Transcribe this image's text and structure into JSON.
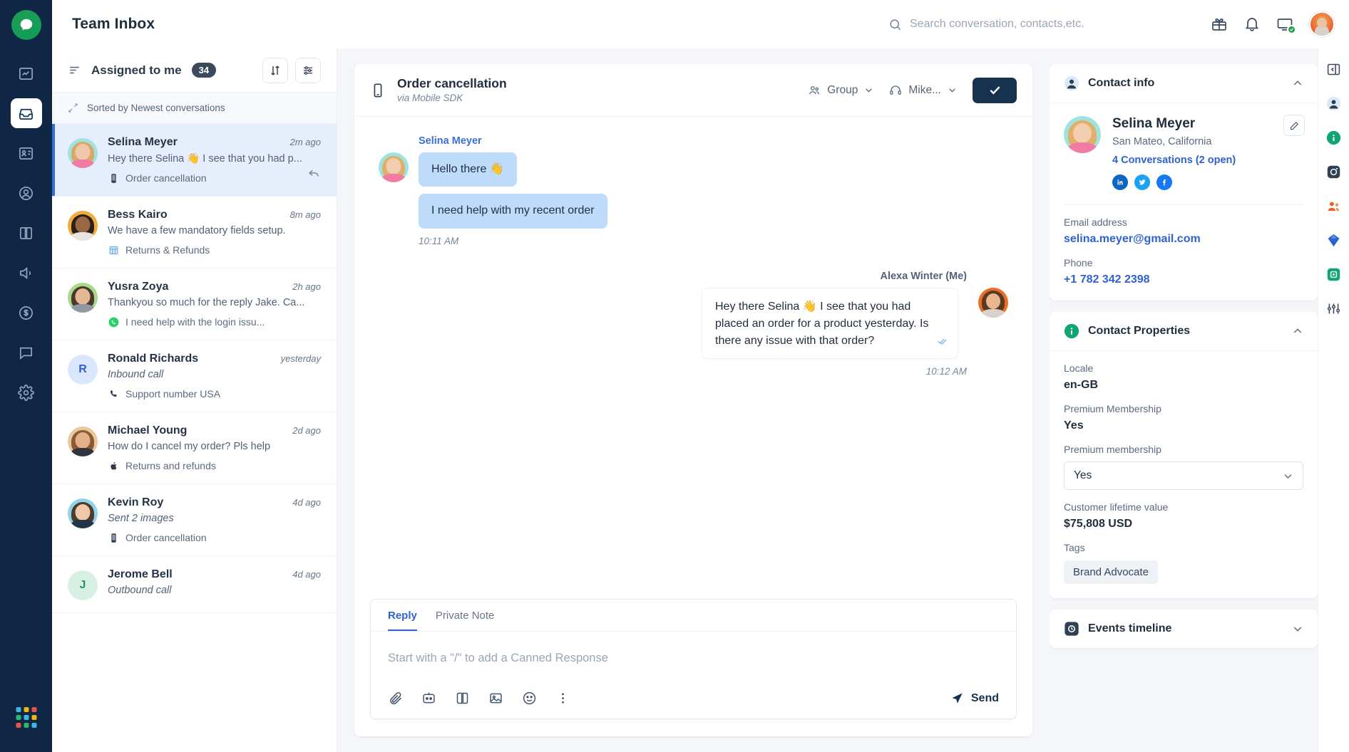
{
  "header": {
    "title": "Team Inbox",
    "search_placeholder": "Search conversation, contacts,etc.",
    "icons": [
      "gift-icon",
      "bell-icon",
      "screen-share-icon",
      "avatar"
    ]
  },
  "sidebar_rail": {
    "items": [
      {
        "name": "logo",
        "icon": "chat-logo-icon"
      },
      {
        "name": "reports",
        "icon": "report-icon"
      },
      {
        "name": "inbox",
        "icon": "inbox-icon",
        "active": true
      },
      {
        "name": "contacts-cards",
        "icon": "id-card-icon"
      },
      {
        "name": "contacts",
        "icon": "user-circle-icon"
      },
      {
        "name": "knowledge-base",
        "icon": "book-icon"
      },
      {
        "name": "campaigns",
        "icon": "megaphone-icon"
      },
      {
        "name": "billing",
        "icon": "dollar-icon"
      },
      {
        "name": "chat",
        "icon": "speech-bubble-icon"
      },
      {
        "name": "settings",
        "icon": "gear-icon"
      }
    ]
  },
  "conversation_list": {
    "filter_label": "Assigned to me",
    "count": "34",
    "sorted_label": "Sorted by Newest conversations",
    "sort_button": "sort-icon",
    "filter_button": "filter-icon",
    "items": [
      {
        "name": "Selina Meyer",
        "time": "2m ago",
        "snippet": "Hey there Selina 👋 I see that you had p...",
        "tag": "Order cancellation",
        "tag_icon": "mobile-icon",
        "selected": true,
        "italic": false,
        "avatar_type": "photo",
        "avatar_bg": "#9fe3de",
        "skin": "#f0c7ab",
        "hair": "#d8a86a",
        "shirt": "#f07ba3"
      },
      {
        "name": "Bess Kairo",
        "time": "8m ago",
        "snippet": "We have a few mandatory fields setup.",
        "tag": "Returns & Refunds",
        "tag_icon": "grid-icon",
        "selected": false,
        "italic": false,
        "avatar_type": "photo",
        "avatar_bg": "#f0ad3f",
        "skin": "#9c6844",
        "hair": "#2b1f18",
        "shirt": "#e8e4df"
      },
      {
        "name": "Yusra Zoya",
        "time": "2h ago",
        "snippet": "Thankyou so much for the reply Jake. Ca...",
        "tag": "I need help with the login issu...",
        "tag_icon": "whatsapp-icon",
        "selected": false,
        "italic": false,
        "avatar_type": "photo",
        "avatar_bg": "#a7d98a",
        "skin": "#e5b894",
        "hair": "#4a3a2e",
        "shirt": "#8f98a3"
      },
      {
        "name": "Ronald Richards",
        "time": "yesterday",
        "snippet": "Inbound call",
        "tag": "Support number USA",
        "tag_icon": "phone-icon",
        "selected": false,
        "italic": true,
        "avatar_type": "initial",
        "initial": "R",
        "avatar_bg": "#d9e6fb",
        "initial_color": "#2f62d0"
      },
      {
        "name": "Michael Young",
        "time": "2d ago",
        "snippet": "How do I cancel my order? Pls help",
        "tag": "Returns and refunds",
        "tag_icon": "apple-icon",
        "selected": false,
        "italic": false,
        "avatar_type": "photo",
        "avatar_bg": "#e8c89c",
        "skin": "#e3b089",
        "hair": "#8a5a33",
        "shirt": "#2e3440"
      },
      {
        "name": "Kevin Roy",
        "time": "4d ago",
        "snippet": "Sent 2 images",
        "tag": "Order cancellation",
        "tag_icon": "mobile-icon",
        "selected": false,
        "italic": true,
        "avatar_type": "photo",
        "avatar_bg": "#8fd4e8",
        "skin": "#f0c7a8",
        "hair": "#4a3b2c",
        "shirt": "#243447"
      },
      {
        "name": "Jerome Bell",
        "time": "4d ago",
        "snippet": "Outbound call",
        "tag": "",
        "tag_icon": "",
        "selected": false,
        "italic": true,
        "avatar_type": "initial",
        "initial": "J",
        "avatar_bg": "#d7f0e4",
        "initial_color": "#2f8f66"
      }
    ]
  },
  "conversation": {
    "title": "Order cancellation",
    "subtitle": "via Mobile SDK",
    "channel_icon": "mobile-icon",
    "team_dropdown": "Group",
    "team_icon": "team-icon",
    "agent_dropdown": "Mike...",
    "agent_icon": "headset-icon",
    "resolve_icon": "check-icon",
    "messages": [
      {
        "direction": "in",
        "sender": "Selina Meyer",
        "bubbles": [
          "Hello there 👋",
          "I need help with my recent order"
        ],
        "time": "10:11 AM"
      },
      {
        "direction": "out",
        "sender": "Alexa Winter (Me)",
        "bubbles": [
          "Hey there Selina 👋 I see that you had placed an order for a product yesterday. Is there any issue with that order?"
        ],
        "time": "10:12 AM",
        "status_icon": "double-check-icon"
      }
    ],
    "composer": {
      "tabs": [
        {
          "label": "Reply",
          "active": true
        },
        {
          "label": "Private Note",
          "active": false
        }
      ],
      "placeholder": "Start with a \"/\" to add a Canned Response",
      "tools": [
        "attachment-icon",
        "bot-icon",
        "knowledge-icon",
        "image-icon",
        "emoji-icon",
        "more-icon"
      ],
      "send_label": "Send",
      "send_icon": "send-icon"
    }
  },
  "contact_panel": {
    "info": {
      "title": "Contact info",
      "title_icon": "contact-icon",
      "collapse_icon": "chevron-up-icon",
      "edit_icon": "pencil-icon",
      "name": "Selina Meyer",
      "location": "San Mateo, California",
      "conversations": "4 Conversations (2 open)",
      "socials": [
        "linkedin-icon",
        "twitter-icon",
        "facebook-icon"
      ],
      "email_label": "Email address",
      "email_value": "selina.meyer@gmail.com",
      "phone_label": "Phone",
      "phone_value": "+1 782 342 2398"
    },
    "properties": {
      "title": "Contact Properties",
      "title_icon": "info-icon",
      "collapse_icon": "chevron-up-icon",
      "fields": [
        {
          "label": "Locale",
          "value": "en-GB",
          "type": "text"
        },
        {
          "label": "Premium Membership",
          "value": "Yes",
          "type": "text"
        },
        {
          "label": "Premium membership",
          "value": "Yes",
          "type": "select"
        },
        {
          "label": "Customer lifetime value",
          "value": "$75,808 USD",
          "type": "text"
        },
        {
          "label": "Tags",
          "value": "Brand Advocate",
          "type": "chip"
        }
      ]
    },
    "events": {
      "title": "Events timeline",
      "title_icon": "timeline-icon",
      "collapse_icon": "chevron-down-icon"
    }
  },
  "far_rail": {
    "items": [
      {
        "name": "collapse-panel",
        "icon": "panel-collapse-icon"
      },
      {
        "name": "contact",
        "icon": "contact-icon"
      },
      {
        "name": "info",
        "icon": "info-icon"
      },
      {
        "name": "instagram",
        "icon": "instagram-icon"
      },
      {
        "name": "people",
        "icon": "people-icon"
      },
      {
        "name": "shopify",
        "icon": "diamond-icon"
      },
      {
        "name": "integration",
        "icon": "app-icon"
      },
      {
        "name": "settings",
        "icon": "sliders-icon"
      }
    ]
  },
  "colors": {
    "rail_bg": "#0f2744",
    "accent": "#2f62d0",
    "resolve": "#17324f",
    "bubble_in": "#bfdbfa",
    "selected_row": "#e6edfb"
  }
}
